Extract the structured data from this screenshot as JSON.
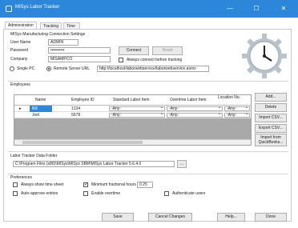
{
  "window": {
    "title": "MISys Labor Tracker",
    "minimize": "—",
    "maximize": "☐",
    "close": "✕"
  },
  "tabs": [
    "Administration",
    "Tracking",
    "Time Sheet"
  ],
  "connection": {
    "heading": "MISys Manufacturing Connection Settings",
    "user_name_label": "User Name",
    "user_name": "ADMIN",
    "password_label": "Password",
    "password": "••••••••••",
    "company_label": "Company",
    "company": "MISAMPCO",
    "connect_label": "Connect",
    "reset_label": "Reset",
    "always_connect_label": "Always connect before tracking",
    "single_pc_label": "Single PC",
    "remote_label": "Remote Server URL",
    "remote_url": "http://localhost/laborwebservice/laborwebservice.asmx"
  },
  "employees": {
    "heading": "Employees",
    "columns": [
      "Name",
      "Employee ID",
      "Standard Labor Item",
      "Overtime Labor Item",
      "Location No."
    ],
    "rows": [
      {
        "marker": "▸",
        "name": "Bill",
        "id": "1234",
        "std": "-Any-",
        "ot": "-Any-",
        "loc": "-Any-"
      },
      {
        "marker": "",
        "name": "Joel",
        "id": "5678",
        "std": "-Any-",
        "ot": "-Any-",
        "loc": "-Any-"
      }
    ],
    "buttons": {
      "add": "Add...",
      "delete": "Delete",
      "import_csv": "Import CSV...",
      "export_csv": "Export CSV...",
      "import_qb": "Import from QuickBooks..."
    }
  },
  "data_folder": {
    "heading": "Labor Tracker Data Folder",
    "path": "C:\\Program Files (x86)\\MISys\\MISys SBM\\MISys Labor Tracker 5.6.4.0",
    "browse_label": "..."
  },
  "preferences": {
    "heading": "Preferences",
    "always_show_label": "Always show time sheet",
    "min_hours_label": "Minimum fractional hours",
    "min_hours_value": "0.25",
    "auth_users_label": "Authenticate users",
    "auto_approve_label": "Auto-approve entries",
    "enable_overtime_label": "Enable overtime"
  },
  "footer": {
    "save": "Save",
    "cancel": "Cancel Changes",
    "help": "Help...",
    "done": "Done"
  },
  "colors": {
    "accent": "#2c86d9",
    "grid_bg": "#a9a9a9"
  }
}
